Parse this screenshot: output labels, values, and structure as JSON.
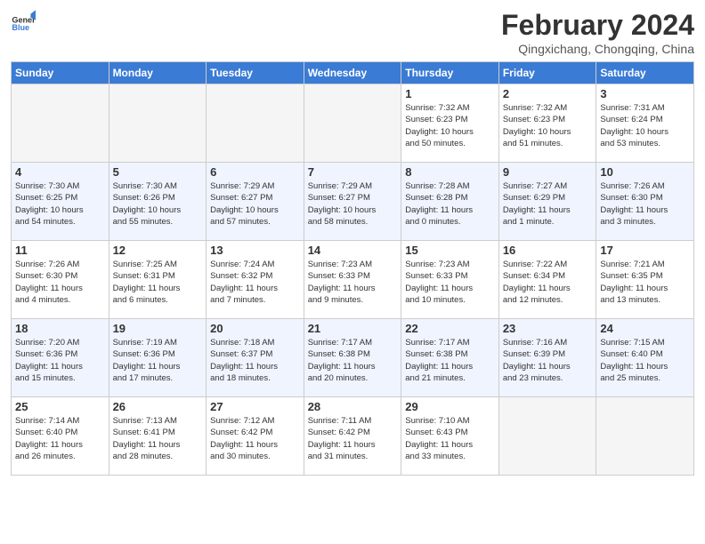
{
  "header": {
    "logo": {
      "general": "General",
      "blue": "Blue"
    },
    "title": "February 2024",
    "location": "Qingxichang, Chongqing, China"
  },
  "days_of_week": [
    "Sunday",
    "Monday",
    "Tuesday",
    "Wednesday",
    "Thursday",
    "Friday",
    "Saturday"
  ],
  "weeks": [
    [
      {
        "day": "",
        "info": ""
      },
      {
        "day": "",
        "info": ""
      },
      {
        "day": "",
        "info": ""
      },
      {
        "day": "",
        "info": ""
      },
      {
        "day": "1",
        "info": "Sunrise: 7:32 AM\nSunset: 6:23 PM\nDaylight: 10 hours\nand 50 minutes."
      },
      {
        "day": "2",
        "info": "Sunrise: 7:32 AM\nSunset: 6:23 PM\nDaylight: 10 hours\nand 51 minutes."
      },
      {
        "day": "3",
        "info": "Sunrise: 7:31 AM\nSunset: 6:24 PM\nDaylight: 10 hours\nand 53 minutes."
      }
    ],
    [
      {
        "day": "4",
        "info": "Sunrise: 7:30 AM\nSunset: 6:25 PM\nDaylight: 10 hours\nand 54 minutes."
      },
      {
        "day": "5",
        "info": "Sunrise: 7:30 AM\nSunset: 6:26 PM\nDaylight: 10 hours\nand 55 minutes."
      },
      {
        "day": "6",
        "info": "Sunrise: 7:29 AM\nSunset: 6:27 PM\nDaylight: 10 hours\nand 57 minutes."
      },
      {
        "day": "7",
        "info": "Sunrise: 7:29 AM\nSunset: 6:27 PM\nDaylight: 10 hours\nand 58 minutes."
      },
      {
        "day": "8",
        "info": "Sunrise: 7:28 AM\nSunset: 6:28 PM\nDaylight: 11 hours\nand 0 minutes."
      },
      {
        "day": "9",
        "info": "Sunrise: 7:27 AM\nSunset: 6:29 PM\nDaylight: 11 hours\nand 1 minute."
      },
      {
        "day": "10",
        "info": "Sunrise: 7:26 AM\nSunset: 6:30 PM\nDaylight: 11 hours\nand 3 minutes."
      }
    ],
    [
      {
        "day": "11",
        "info": "Sunrise: 7:26 AM\nSunset: 6:30 PM\nDaylight: 11 hours\nand 4 minutes."
      },
      {
        "day": "12",
        "info": "Sunrise: 7:25 AM\nSunset: 6:31 PM\nDaylight: 11 hours\nand 6 minutes."
      },
      {
        "day": "13",
        "info": "Sunrise: 7:24 AM\nSunset: 6:32 PM\nDaylight: 11 hours\nand 7 minutes."
      },
      {
        "day": "14",
        "info": "Sunrise: 7:23 AM\nSunset: 6:33 PM\nDaylight: 11 hours\nand 9 minutes."
      },
      {
        "day": "15",
        "info": "Sunrise: 7:23 AM\nSunset: 6:33 PM\nDaylight: 11 hours\nand 10 minutes."
      },
      {
        "day": "16",
        "info": "Sunrise: 7:22 AM\nSunset: 6:34 PM\nDaylight: 11 hours\nand 12 minutes."
      },
      {
        "day": "17",
        "info": "Sunrise: 7:21 AM\nSunset: 6:35 PM\nDaylight: 11 hours\nand 13 minutes."
      }
    ],
    [
      {
        "day": "18",
        "info": "Sunrise: 7:20 AM\nSunset: 6:36 PM\nDaylight: 11 hours\nand 15 minutes."
      },
      {
        "day": "19",
        "info": "Sunrise: 7:19 AM\nSunset: 6:36 PM\nDaylight: 11 hours\nand 17 minutes."
      },
      {
        "day": "20",
        "info": "Sunrise: 7:18 AM\nSunset: 6:37 PM\nDaylight: 11 hours\nand 18 minutes."
      },
      {
        "day": "21",
        "info": "Sunrise: 7:17 AM\nSunset: 6:38 PM\nDaylight: 11 hours\nand 20 minutes."
      },
      {
        "day": "22",
        "info": "Sunrise: 7:17 AM\nSunset: 6:38 PM\nDaylight: 11 hours\nand 21 minutes."
      },
      {
        "day": "23",
        "info": "Sunrise: 7:16 AM\nSunset: 6:39 PM\nDaylight: 11 hours\nand 23 minutes."
      },
      {
        "day": "24",
        "info": "Sunrise: 7:15 AM\nSunset: 6:40 PM\nDaylight: 11 hours\nand 25 minutes."
      }
    ],
    [
      {
        "day": "25",
        "info": "Sunrise: 7:14 AM\nSunset: 6:40 PM\nDaylight: 11 hours\nand 26 minutes."
      },
      {
        "day": "26",
        "info": "Sunrise: 7:13 AM\nSunset: 6:41 PM\nDaylight: 11 hours\nand 28 minutes."
      },
      {
        "day": "27",
        "info": "Sunrise: 7:12 AM\nSunset: 6:42 PM\nDaylight: 11 hours\nand 30 minutes."
      },
      {
        "day": "28",
        "info": "Sunrise: 7:11 AM\nSunset: 6:42 PM\nDaylight: 11 hours\nand 31 minutes."
      },
      {
        "day": "29",
        "info": "Sunrise: 7:10 AM\nSunset: 6:43 PM\nDaylight: 11 hours\nand 33 minutes."
      },
      {
        "day": "",
        "info": ""
      },
      {
        "day": "",
        "info": ""
      }
    ]
  ]
}
